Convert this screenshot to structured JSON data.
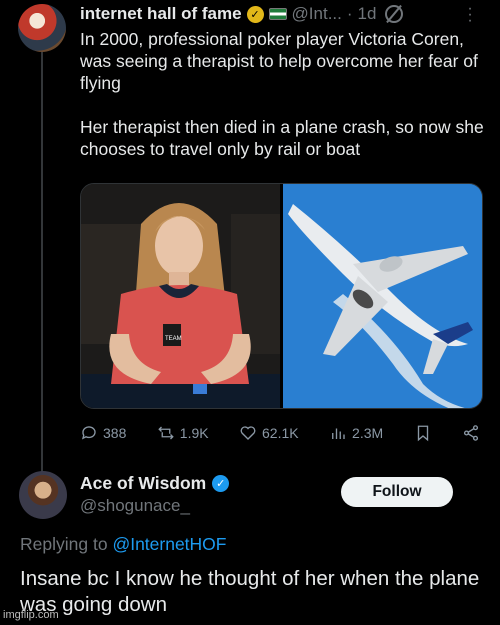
{
  "tweet": {
    "display_name": "internet hall of fame",
    "handle": "@Int...",
    "separator": "·",
    "time": "1d",
    "text_lines": [
      "In 2000, professional poker player Victoria Coren, was seeing a therapist to help overcome her fear of flying",
      "Her therapist then died in a plane crash, so now she chooses to travel only by rail or boat"
    ],
    "images": [
      {
        "description_icon": "poker-player-photo",
        "badge_text": "TEAM"
      },
      {
        "description_icon": "airplane-photo"
      }
    ],
    "stats": {
      "replies": "388",
      "reposts": "1.9K",
      "likes": "62.1K",
      "views": "2.3M"
    }
  },
  "reply": {
    "display_name": "Ace of Wisdom",
    "handle": "@shogunace_",
    "follow_label": "Follow",
    "replying_prefix": "Replying to",
    "replying_mention": "@InternetHOF",
    "text": "Insane bc I know he thought of her when the plane was going down"
  },
  "watermark": "imgflip.com",
  "colors": {
    "background": "#000000",
    "text": "#e7e9ea",
    "muted": "#71767b",
    "link": "#1d9bf0",
    "gold_badge": "#e2b719",
    "blue_badge": "#1d9bf0"
  }
}
